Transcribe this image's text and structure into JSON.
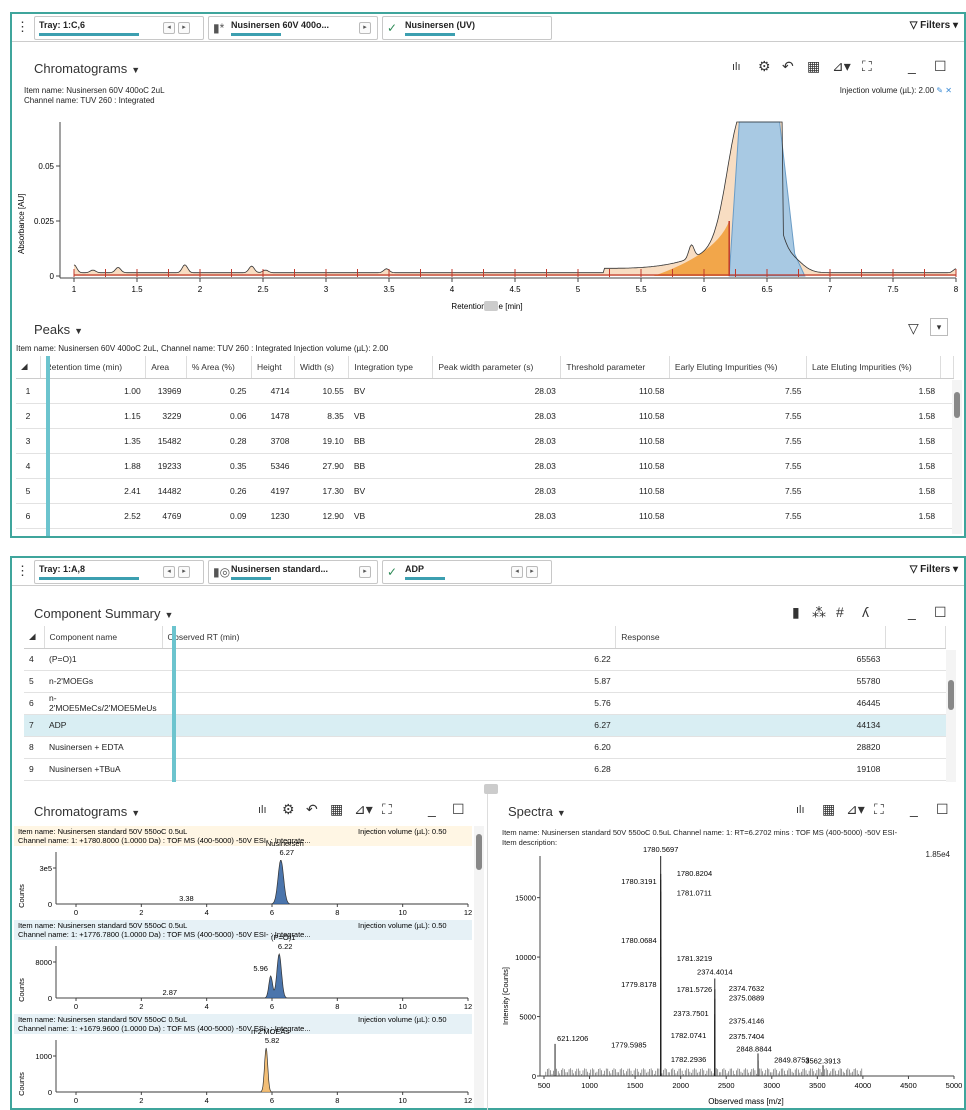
{
  "top": {
    "filterbar": {
      "tray": "Tray: 1:C,6",
      "sample": "Nusinersen 60V 400o...",
      "channel": "Nusinersen (UV)",
      "filters_label": "Filters"
    },
    "chrom_title": "Chromatograms",
    "item_name": "Item name: Nusinersen 60V 400oC 2uL",
    "channel_name": "Channel name: TUV 260 : Integrated",
    "injection": "Injection volume (µL): 2.00",
    "ylabel": "Absorbance [AU]",
    "xlabel": "Retention time [min]",
    "peaks_title": "Peaks",
    "peaks_desc": "Item name: Nusinersen 60V 400oC 2uL, Channel name: TUV 260 : Integrated Injection volume (µL): 2.00",
    "peak_headers": [
      "Retention time (min)",
      "Area",
      "% Area (%)",
      "Height",
      "Width (s)",
      "Integration type",
      "Peak width parameter (s)",
      "Threshold parameter",
      "Early Eluting Impurities (%)",
      "Late Eluting Impurities (%)"
    ],
    "peak_rows": [
      [
        "1",
        "1.00",
        "13969",
        "0.25",
        "4714",
        "10.55",
        "BV",
        "28.03",
        "110.58",
        "7.55",
        "1.58"
      ],
      [
        "2",
        "1.15",
        "3229",
        "0.06",
        "1478",
        "8.35",
        "VB",
        "28.03",
        "110.58",
        "7.55",
        "1.58"
      ],
      [
        "3",
        "1.35",
        "15482",
        "0.28",
        "3708",
        "19.10",
        "BB",
        "28.03",
        "110.58",
        "7.55",
        "1.58"
      ],
      [
        "4",
        "1.88",
        "19233",
        "0.35",
        "5346",
        "27.90",
        "BB",
        "28.03",
        "110.58",
        "7.55",
        "1.58"
      ],
      [
        "5",
        "2.41",
        "14482",
        "0.26",
        "4197",
        "17.30",
        "BV",
        "28.03",
        "110.58",
        "7.55",
        "1.58"
      ],
      [
        "6",
        "2.52",
        "4769",
        "0.09",
        "1230",
        "12.90",
        "VB",
        "28.03",
        "110.58",
        "7.55",
        "1.58"
      ]
    ]
  },
  "bottom": {
    "filterbar": {
      "tray": "Tray: 1:A,8",
      "sample": "Nusinersen standard...",
      "channel": "ADP",
      "filters_label": "Filters"
    },
    "summary_title": "Component Summary",
    "comp_headers": [
      "Component name",
      "Observed RT (min)",
      "Response"
    ],
    "comp_rows": [
      [
        "4",
        "(P=O)1",
        "6.22",
        "65563"
      ],
      [
        "5",
        "n-2'MOEGs",
        "5.87",
        "55780"
      ],
      [
        "6",
        "n-2'MOE5MeCs/2'MOE5MeUs",
        "5.76",
        "46445"
      ],
      [
        "7",
        "ADP",
        "6.27",
        "44134"
      ],
      [
        "8",
        "Nusinersen + EDTA",
        "6.20",
        "28820"
      ],
      [
        "9",
        "Nusinersen +TBuA",
        "6.28",
        "19108"
      ]
    ],
    "chrom_title": "Chromatograms",
    "spectra_title": "Spectra",
    "traces": [
      {
        "item": "Item name: Nusinersen standard 50V 550oC 0.5uL",
        "channel": "Channel name: 1: +1780.8000 (1.0000 Da) : TOF MS (400-5000) -50V ESI- : Integrate...",
        "inj": "Injection volume (µL): 0.50",
        "ytick": "3e5",
        "peak_label": "Nusinersen",
        "peak_rt": "6.27",
        "minor": "3.38"
      },
      {
        "item": "Item name: Nusinersen standard 50V 550oC 0.5uL",
        "channel": "Channel name: 1: +1776.7800 (1.0000 Da) : TOF MS (400-5000) -50V ESI- : Integrate...",
        "inj": "Injection volume (µL): 0.50",
        "ytick": "8000",
        "peak_label": "(P=O)1",
        "peak_rt": "6.22",
        "peak2": "5.96",
        "minor": "2.87"
      },
      {
        "item": "Item name: Nusinersen standard 50V 550oC 0.5uL",
        "channel": "Channel name: 1: +1679.9600 (1.0000 Da) : TOF MS (400-5000) -50V ESI- : Integrate...",
        "inj": "Injection volume (µL): 0.50",
        "ytick": "1000",
        "peak_label": "n-2'MOEAs",
        "peak_rt": "5.82"
      }
    ],
    "counts_label": "Counts",
    "spectra_item": "Item name: Nusinersen standard 50V 550oC 0.5uL    Channel name: 1: RT=6.2702 mins : TOF MS (400-5000) -50V ESI-",
    "spectra_desc": "Item description:",
    "spectra_max": "1.85e4",
    "spectra_ylabel": "Intensity [Counts]",
    "spectra_xlabel": "Observed mass [m/z]"
  },
  "chart_data": [
    {
      "type": "line",
      "ylabel": "Absorbance [AU]",
      "xlabel": "Retention time [min]",
      "xlim": [
        1,
        8
      ],
      "ylim": [
        0,
        0.07
      ],
      "xticks": [
        "1",
        "1.5",
        "2",
        "2.5",
        "3",
        "3.5",
        "4",
        "4.5",
        "5",
        "5.5",
        "6",
        "6.5",
        "7",
        "7.5",
        "8"
      ],
      "yticks": [
        "0",
        "0.025",
        "0.05"
      ],
      "x": [
        1.0,
        1.15,
        1.35,
        1.88,
        2.41,
        2.52,
        3.48,
        5.9,
        6.2,
        6.3,
        6.5,
        6.7,
        8.0
      ],
      "y": [
        0.006,
        0.002,
        0.004,
        0.006,
        0.005,
        0.002,
        0.003,
        0.01,
        0.025,
        0.07,
        0.07,
        0.01,
        0.003
      ]
    },
    {
      "type": "bar",
      "ylabel": "Intensity [Counts]",
      "xlabel": "Observed mass [m/z]",
      "xlim": [
        500,
        5000
      ],
      "ylim": [
        0,
        18500
      ],
      "xticks": [
        "500",
        "1000",
        "1500",
        "2000",
        "2500",
        "3000",
        "3500",
        "4000",
        "4500",
        "5000"
      ],
      "yticks": [
        "0",
        "5000",
        "10000",
        "15000"
      ],
      "peaks": [
        {
          "mz": 1780.5697,
          "label": "1780.5697",
          "intensity": 18500
        },
        {
          "mz": 1780.8204,
          "label": "1780.8204",
          "intensity": 17000
        },
        {
          "mz": 1780.3191,
          "label": "1780.3191",
          "intensity": 16500
        },
        {
          "mz": 1781.0711,
          "label": "1781.0711",
          "intensity": 15500
        },
        {
          "mz": 1780.0684,
          "label": "1780.0684",
          "intensity": 11500
        },
        {
          "mz": 1781.3219,
          "label": "1781.3219",
          "intensity": 10000
        },
        {
          "mz": 2374.4014,
          "label": "2374.4014",
          "intensity": 8200
        },
        {
          "mz": 1779.8178,
          "label": "1779.8178",
          "intensity": 7800
        },
        {
          "mz": 1781.5726,
          "label": "1781.5726",
          "intensity": 7400
        },
        {
          "mz": 2374.7632,
          "label": "2374.7632",
          "intensity": 7300
        },
        {
          "mz": 2375.0889,
          "label": "2375.0889",
          "intensity": 6500
        },
        {
          "mz": 2373.7501,
          "label": "2373.7501",
          "intensity": 5200
        },
        {
          "mz": 2375.4146,
          "label": "2375.4146",
          "intensity": 4600
        },
        {
          "mz": 621.1206,
          "label": "621.1206",
          "intensity": 2700
        },
        {
          "mz": 1782.0741,
          "label": "1782.0741",
          "intensity": 3200
        },
        {
          "mz": 2375.7404,
          "label": "2375.7404",
          "intensity": 3300
        },
        {
          "mz": 1779.5985,
          "label": "1779.5985",
          "intensity": 2400
        },
        {
          "mz": 1782.2936,
          "label": "1782.2936",
          "intensity": 1500
        },
        {
          "mz": 2848.8844,
          "label": "2848.8844",
          "intensity": 1900
        },
        {
          "mz": 2849.8753,
          "label": "2849.8753",
          "intensity": 1300
        },
        {
          "mz": 3562.3913,
          "label": "3562.3913",
          "intensity": 900
        }
      ]
    }
  ]
}
